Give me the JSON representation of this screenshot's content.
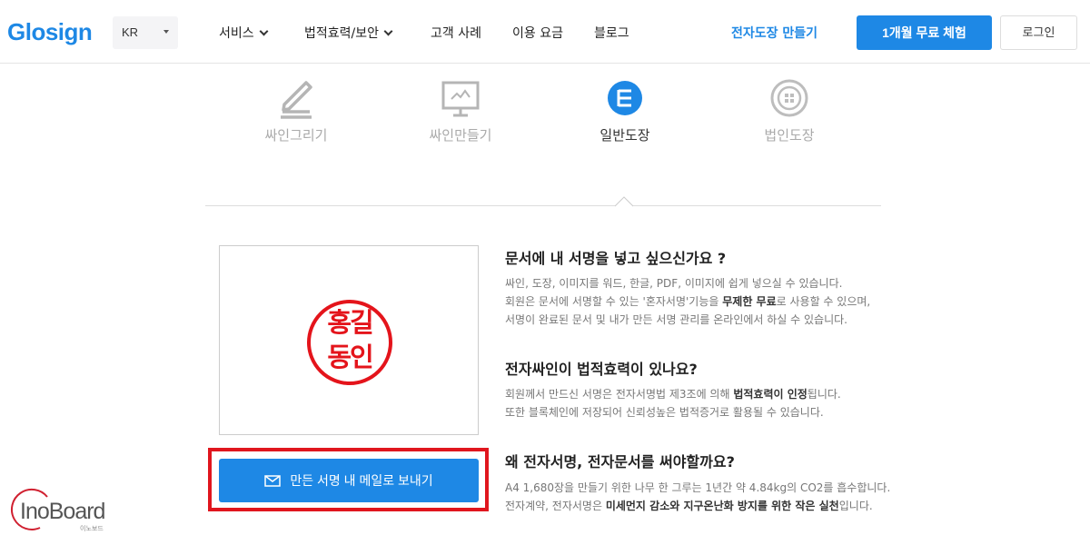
{
  "header": {
    "logo": "Glosign",
    "language": "KR",
    "nav": [
      {
        "label": "서비스",
        "has_dropdown": true
      },
      {
        "label": "법적효력/보안",
        "has_dropdown": true
      },
      {
        "label": "고객 사례",
        "has_dropdown": false
      },
      {
        "label": "이용 요금",
        "has_dropdown": false
      },
      {
        "label": "블로그",
        "has_dropdown": false
      }
    ],
    "stamp_link": "전자도장 만들기",
    "trial_button": "1개월 무료 체험",
    "login_button": "로그인"
  },
  "tabs": [
    {
      "label": "싸인그리기",
      "icon": "pen-draw-icon",
      "active": false
    },
    {
      "label": "싸인만들기",
      "icon": "monitor-sign-icon",
      "active": false
    },
    {
      "label": "일반도장",
      "icon": "general-stamp-icon",
      "active": true
    },
    {
      "label": "법인도장",
      "icon": "corporate-stamp-icon",
      "active": false
    }
  ],
  "preview": {
    "seal_line1": "홍길",
    "seal_line2": "동인"
  },
  "send_button": "만든 서명 내 메일로 보내기",
  "faq": [
    {
      "question": "문서에 내 서명을 넣고 싶으신가요 ?",
      "lines": [
        {
          "pre": "싸인, 도장, 이미지를 워드, 한글, PDF, 이미지에 쉽게 넣으실 수 있습니다.",
          "bold": "",
          "post": ""
        },
        {
          "pre": "회원은 문서에 서명할 수 있는 '혼자서명'기능을 ",
          "bold": "무제한 무료",
          "post": "로 사용할 수 있으며,"
        },
        {
          "pre": "서명이 완료된 문서 및 내가 만든 서명 관리를 온라인에서 하실 수 있습니다.",
          "bold": "",
          "post": ""
        }
      ]
    },
    {
      "question": "전자싸인이 법적효력이 있나요?",
      "lines": [
        {
          "pre": "회원께서 만드신 서명은 전자서명법 제3조에 의해 ",
          "bold": "법적효력이 인정",
          "post": "됩니다."
        },
        {
          "pre": "또한 블록체인에 저장되어 신뢰성높은 법적증거로 활용될 수 있습니다.",
          "bold": "",
          "post": ""
        }
      ]
    },
    {
      "question": "왜 전자서명, 전자문서를 써야할까요?",
      "lines": [
        {
          "pre": "A4 1,680장을 만들기 위한 나무 한 그루는 1년간 약 4.84kg의 CO2를 흡수합니다.",
          "bold": "",
          "post": ""
        },
        {
          "pre": "전자계약, 전자서명은 ",
          "bold": "미세먼지 감소와 지구온난화 방지를 위한 작은 실천",
          "post": "입니다."
        }
      ]
    }
  ],
  "watermark": {
    "text": "InoBoard",
    "sub": "이노보드"
  },
  "colors": {
    "accent": "#1e88e5",
    "seal": "#e4141b",
    "highlight_box": "#e0161e"
  }
}
